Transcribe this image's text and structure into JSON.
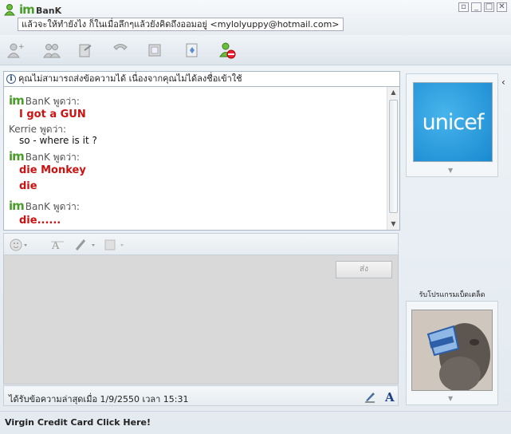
{
  "window": {
    "logo": "im",
    "contact_name": "BanK",
    "status_message": "แล้วจะให้ทำยังไง ก็ในเมื่อลึกๆแล้วยังคิดถึงออมอยู่ <mylolyuppy@hotmail.com>",
    "controls": [
      "▫",
      "_",
      "□",
      "✕"
    ]
  },
  "info": {
    "text": "คุณไม่สามารถส่งข้อความได้ เนื่องจากคุณไม่ได้ลงชื่อเข้าใช้"
  },
  "chat": {
    "messages": [
      {
        "sender_logo": "im",
        "sender": "BanK",
        "says": "พูดว่า:",
        "lines": [
          "I got a GUN"
        ],
        "color": "red"
      },
      {
        "sender_logo": "",
        "sender": "Kerrie",
        "says": "พูดว่า:",
        "lines": [
          "so - where is it ?"
        ],
        "color": "black"
      },
      {
        "sender_logo": "im",
        "sender": "BanK",
        "says": "พูดว่า:",
        "lines": [
          "die Monkey",
          "die"
        ],
        "color": "red"
      },
      {
        "sender_logo": "im",
        "sender": "BanK",
        "says": "พูดว่า:",
        "lines": [
          "die......"
        ],
        "color": "red"
      }
    ]
  },
  "input": {
    "send_label": "ส่ง"
  },
  "status": {
    "last_message": "ได้รับข้อความล่าสุดเมื่อ 1/9/2550 เวลา 15:31"
  },
  "side": {
    "display_picture_text": "unicef",
    "promo_label": "รับโปรแกรมเบ็ดเตล็ด",
    "collapse": "‹"
  },
  "ad": {
    "text": "Virgin Credit Card Click Here!"
  },
  "colors": {
    "red_text": "#cc1111",
    "msn_green": "#4a9d2a",
    "unicef_blue": "#1a8ad0"
  }
}
